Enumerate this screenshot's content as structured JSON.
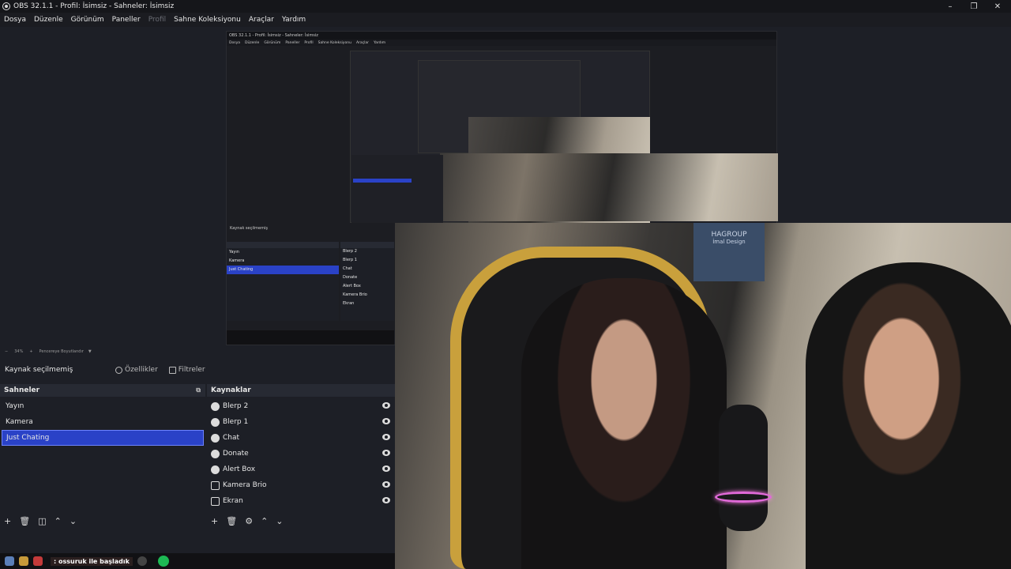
{
  "window": {
    "title": "OBS 32.1.1 - Profil: İsimsiz - Sahneler: İsimsiz",
    "controls": [
      "–",
      "❐",
      "✕"
    ]
  },
  "menu": [
    "Dosya",
    "Düzenle",
    "Görünüm",
    "Paneller",
    "Profil",
    "Sahne Koleksiyonu",
    "Araçlar",
    "Yardım"
  ],
  "nested_window": {
    "title": "OBS 32.1.1 - Profil: İsimsiz - Sahneler: İsimsiz",
    "menu": [
      "Dosya",
      "Düzenle",
      "Görünüm",
      "Paneller",
      "Profil",
      "Sahne Koleksiyonu",
      "Araçlar",
      "Yardım"
    ],
    "toolbar_label": "Kaynak seçilmemiş",
    "scenes": [
      "Yayın",
      "Kamera",
      "Just Chating"
    ],
    "sources": [
      "Blerp 2",
      "Blerp 1",
      "Chat",
      "Donate",
      "Alert Box",
      "Kamera Brio",
      "Ekran"
    ]
  },
  "webcam": {
    "shirt_brand": "HAGROUP",
    "shirt_sub": "İmal Design"
  },
  "zoom": {
    "value": "34%",
    "label": "Pencereye Boyutlandır"
  },
  "source_toolbar": {
    "label": "Kaynak seçilmemiş",
    "properties": "Özellikler",
    "filters": "Filtreler"
  },
  "scenes_dock": {
    "title": "Sahneler",
    "items": [
      "Yayın",
      "Kamera",
      "Just Chating"
    ],
    "selected_index": 2
  },
  "sources_dock": {
    "title": "Kaynaklar",
    "items": [
      {
        "name": "Blerp 2",
        "icon": "browser-icon"
      },
      {
        "name": "Blerp 1",
        "icon": "browser-icon"
      },
      {
        "name": "Chat",
        "icon": "browser-icon"
      },
      {
        "name": "Donate",
        "icon": "browser-icon"
      },
      {
        "name": "Alert Box",
        "icon": "browser-icon"
      },
      {
        "name": "Kamera Brio",
        "icon": "camera-icon"
      },
      {
        "name": "Ekran",
        "icon": "monitor-icon"
      }
    ]
  },
  "taskbar": {
    "ticker": ": ossuruk ile başladık"
  },
  "colors": {
    "selection": "#2a42c7",
    "background": "#1d1f26",
    "spotify": "#1db954"
  }
}
